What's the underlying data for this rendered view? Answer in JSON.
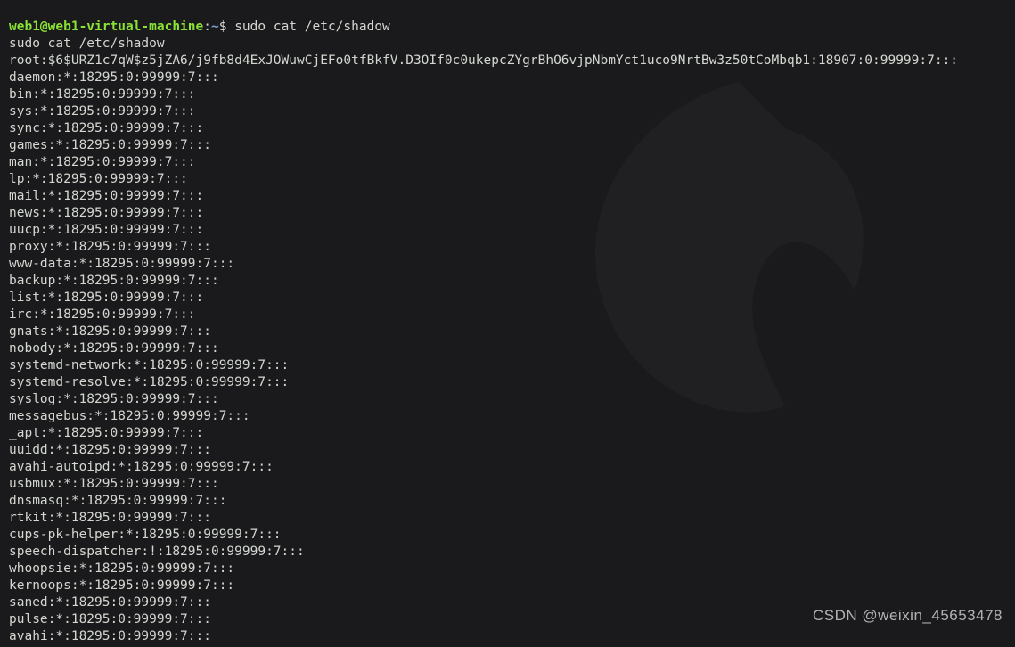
{
  "prompt": {
    "user": "web1@web1-virtual-machine",
    "colon": ":",
    "path": "~",
    "dollar": "$ "
  },
  "command": "sudo cat /etc/shadow",
  "echo": "sudo cat /etc/shadow",
  "outputLines": [
    "root:$6$URZ1c7qW$z5jZA6/j9fb8d4ExJOWuwCjEFo0tfBkfV.D3OIf0c0ukepcZYgrBhO6vjpNbmYct1uco9NrtBw3z50tCoMbqb1:18907:0:99999:7:::",
    "daemon:*:18295:0:99999:7:::",
    "bin:*:18295:0:99999:7:::",
    "sys:*:18295:0:99999:7:::",
    "sync:*:18295:0:99999:7:::",
    "games:*:18295:0:99999:7:::",
    "man:*:18295:0:99999:7:::",
    "lp:*:18295:0:99999:7:::",
    "mail:*:18295:0:99999:7:::",
    "news:*:18295:0:99999:7:::",
    "uucp:*:18295:0:99999:7:::",
    "proxy:*:18295:0:99999:7:::",
    "www-data:*:18295:0:99999:7:::",
    "backup:*:18295:0:99999:7:::",
    "list:*:18295:0:99999:7:::",
    "irc:*:18295:0:99999:7:::",
    "gnats:*:18295:0:99999:7:::",
    "nobody:*:18295:0:99999:7:::",
    "systemd-network:*:18295:0:99999:7:::",
    "systemd-resolve:*:18295:0:99999:7:::",
    "syslog:*:18295:0:99999:7:::",
    "messagebus:*:18295:0:99999:7:::",
    "_apt:*:18295:0:99999:7:::",
    "uuidd:*:18295:0:99999:7:::",
    "avahi-autoipd:*:18295:0:99999:7:::",
    "usbmux:*:18295:0:99999:7:::",
    "dnsmasq:*:18295:0:99999:7:::",
    "rtkit:*:18295:0:99999:7:::",
    "cups-pk-helper:*:18295:0:99999:7:::",
    "speech-dispatcher:!:18295:0:99999:7:::",
    "whoopsie:*:18295:0:99999:7:::",
    "kernoops:*:18295:0:99999:7:::",
    "saned:*:18295:0:99999:7:::",
    "pulse:*:18295:0:99999:7:::",
    "avahi:*:18295:0:99999:7:::"
  ],
  "watermark": "CSDN @weixin_45653478"
}
